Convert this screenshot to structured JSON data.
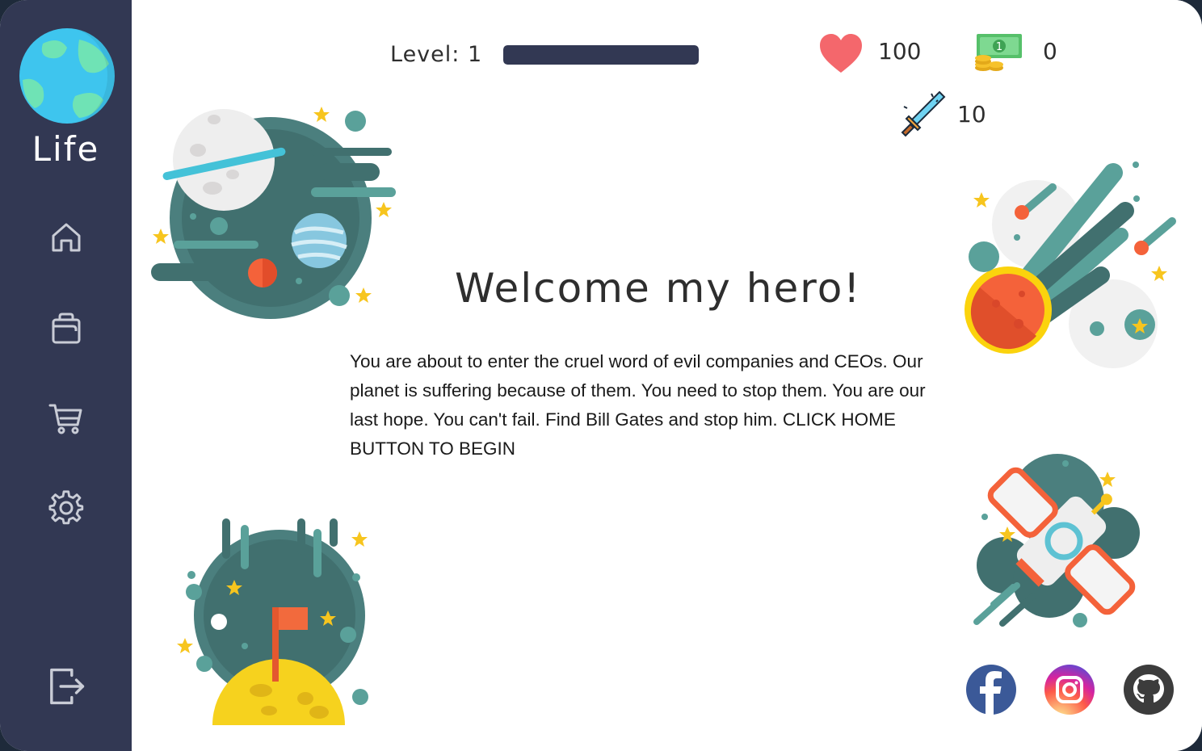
{
  "sidebar": {
    "title": "Life",
    "items": [
      {
        "name": "home",
        "icon": "home-icon"
      },
      {
        "name": "inventory",
        "icon": "bag-icon"
      },
      {
        "name": "shop",
        "icon": "cart-icon"
      },
      {
        "name": "settings",
        "icon": "gear-icon"
      }
    ],
    "logout_icon": "logout-icon"
  },
  "header": {
    "level_label": "Level:",
    "level_value": "1",
    "level_progress": 1.0,
    "health": "100",
    "money": "0",
    "attack": "10"
  },
  "main": {
    "welcome_title": "Welcome my hero!",
    "intro_text": "You are about to enter the cruel word of evil companies and CEOs. Our planet is suffering because of them. You need to stop them. You are our last hope. You can't fail. Find Bill Gates and stop him. CLICK HOME BUTTON TO BEGIN"
  },
  "social": [
    {
      "name": "facebook",
      "icon": "facebook-icon",
      "color": "#3b5998"
    },
    {
      "name": "instagram",
      "icon": "instagram-icon",
      "color": "#e1306c"
    },
    {
      "name": "github",
      "icon": "github-icon",
      "color": "#3c3c3c"
    }
  ],
  "colors": {
    "sidebar": "#323853",
    "accent_teal": "#4a7a78",
    "heart": "#f4676c",
    "star": "#f7c51e"
  }
}
